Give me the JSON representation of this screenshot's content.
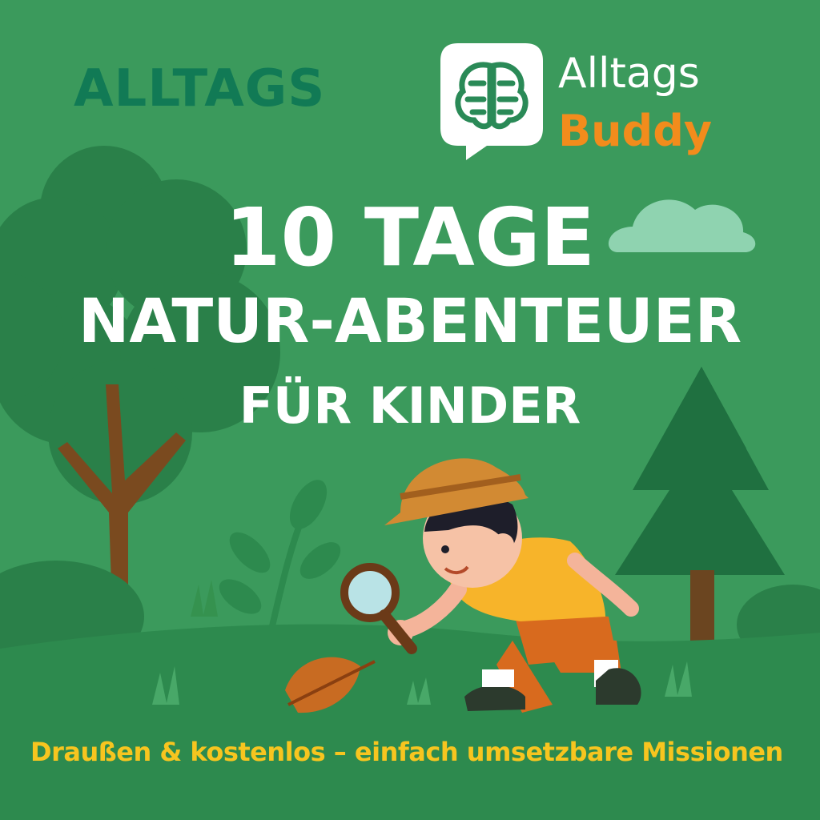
{
  "header": {
    "brand_left": "ALLTAGS",
    "logo": {
      "icon": "brain-speech-bubble-icon",
      "line1": "Alltags",
      "line2": "Buddy"
    }
  },
  "title": {
    "line1": "10 TAGE",
    "line2": "NATUR-ABENTEUER",
    "line3": "FÜR KINDER"
  },
  "tagline": "Draußen & kostenlos – einfach umsetzbare Missionen",
  "colors": {
    "background": "#3b9a5c",
    "brand_dark_green": "#117a55",
    "logo_orange": "#f28c1c",
    "tagline_yellow": "#f7c51f",
    "title_white": "#ffffff"
  }
}
